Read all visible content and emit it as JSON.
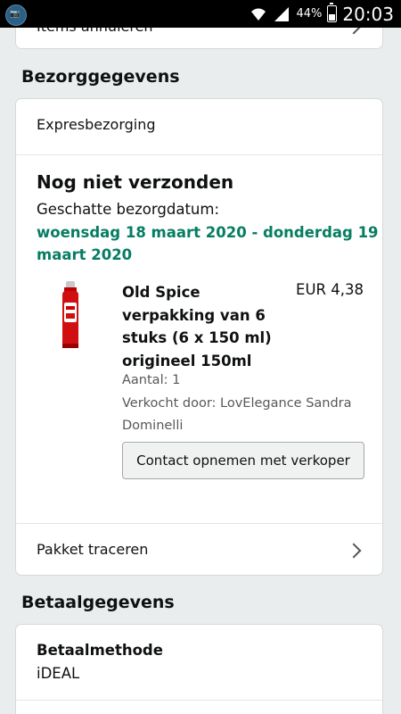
{
  "status_bar": {
    "battery": "44%",
    "time": "20:03"
  },
  "top_card": {
    "label": "Items annuleren"
  },
  "delivery": {
    "section_title": "Bezorggegevens",
    "shipping_method": "Expresbezorging",
    "status_heading": "Nog niet verzonden",
    "estimate_label": "Geschatte bezorgdatum:",
    "estimate_line1": "woensdag 18 maart 2020 - donderdag 19",
    "estimate_line2": "maart 2020",
    "item": {
      "title_lines": [
        "Old Spice",
        "verpakking van 6",
        "stuks (6 x 150 ml)",
        "origineel 150ml"
      ],
      "price": "EUR 4,38",
      "quantity": "Aantal: 1",
      "seller_line1": "Verkocht door: LovElegance Sandra",
      "seller_line2": "Dominelli",
      "contact_button": "Contact opnemen met verkoper"
    },
    "track_label": "Pakket traceren"
  },
  "payment": {
    "section_title": "Betaalgegevens",
    "method_label": "Betaalmethode",
    "method_value": "iDEAL"
  },
  "colors": {
    "accent_green": "#067d62",
    "background": "#eaeded"
  }
}
